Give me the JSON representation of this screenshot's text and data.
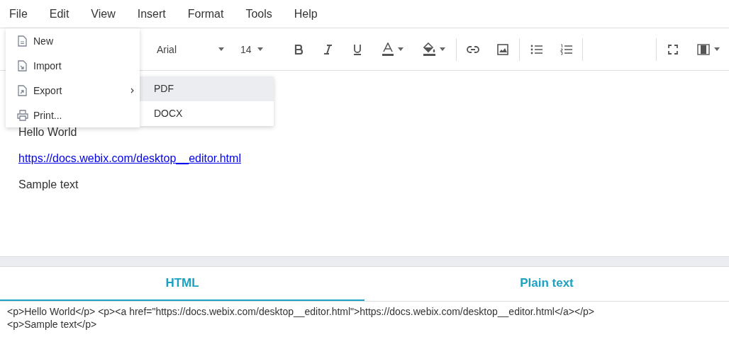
{
  "menubar": [
    {
      "label": "File"
    },
    {
      "label": "Edit"
    },
    {
      "label": "View"
    },
    {
      "label": "Insert"
    },
    {
      "label": "Format"
    },
    {
      "label": "Tools"
    },
    {
      "label": "Help"
    }
  ],
  "file_menu": [
    {
      "label": "New",
      "kind": "new"
    },
    {
      "label": "Import",
      "kind": "import"
    },
    {
      "label": "Export",
      "kind": "export",
      "submenu": true
    },
    {
      "label": "Print...",
      "kind": "print"
    }
  ],
  "export_submenu": [
    {
      "label": "PDF",
      "selected": true
    },
    {
      "label": "DOCX",
      "selected": false
    }
  ],
  "toolbar": {
    "font": "Arial",
    "size": "14"
  },
  "document": [
    {
      "kind": "text",
      "text": "Hello World"
    },
    {
      "kind": "link",
      "text": "https://docs.webix.com/desktop__editor.html"
    },
    {
      "kind": "text",
      "text": "Sample text"
    }
  ],
  "tabs": [
    {
      "label": "HTML",
      "selected": true
    },
    {
      "label": "Plain text",
      "selected": false
    }
  ],
  "output": [
    "<p>Hello World</p> <p><a href=\"https://docs.webix.com/desktop__editor.html\">https://docs.webix.com/desktop__editor.html</a></p>",
    "<p>Sample text</p>"
  ]
}
